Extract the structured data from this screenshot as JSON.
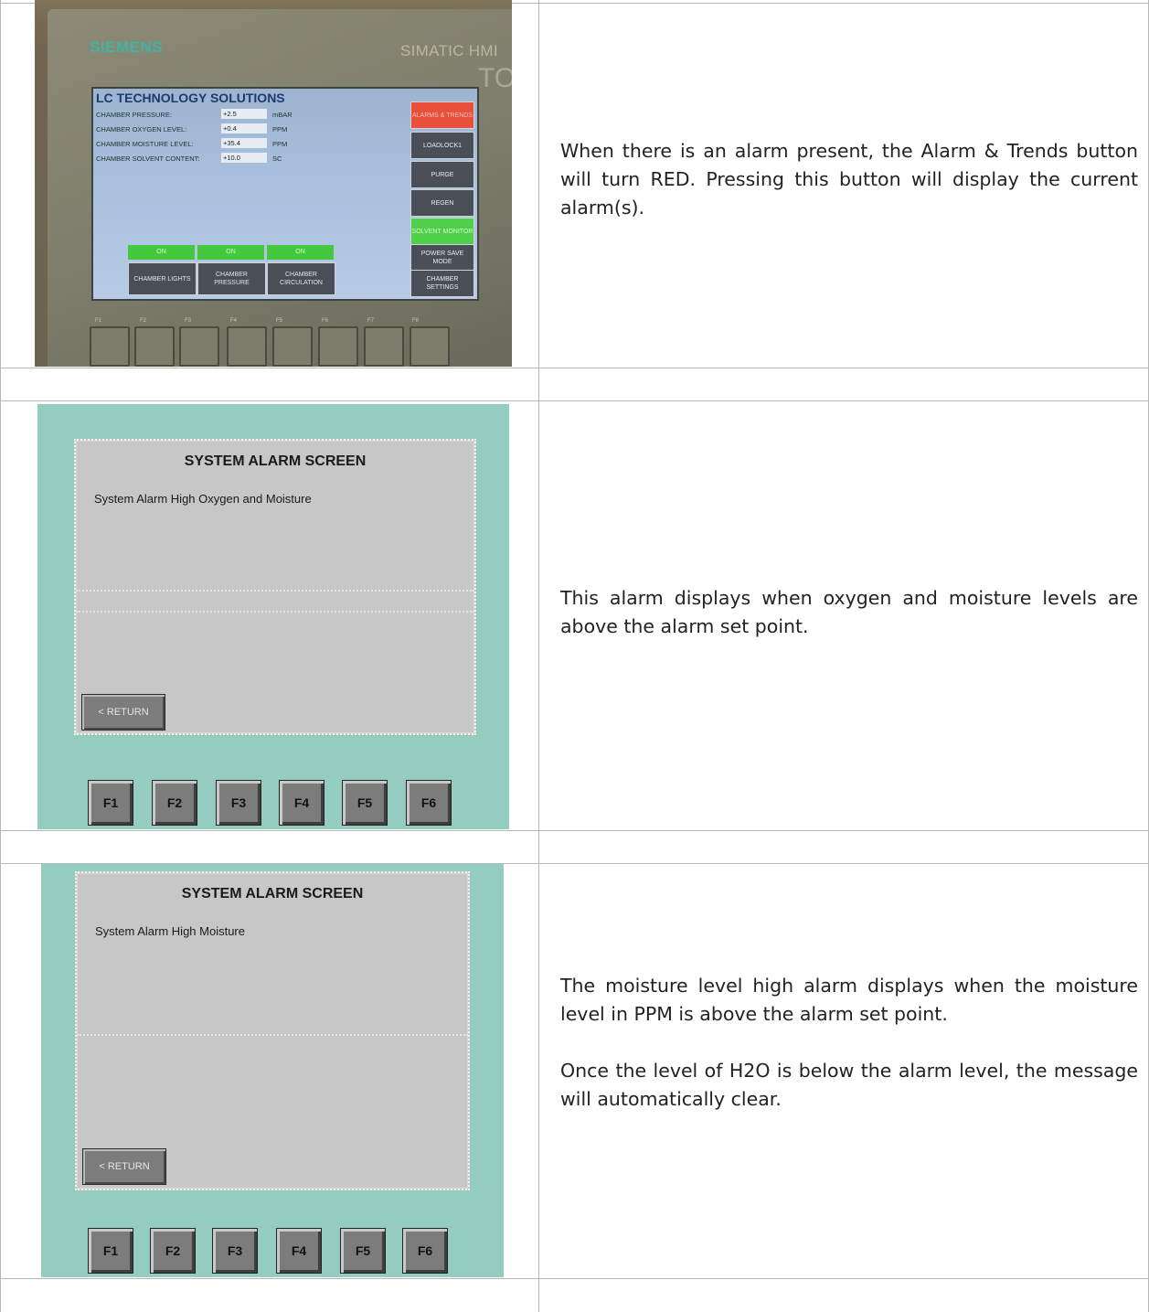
{
  "row1": {
    "description": "When there is an alarm present, the Alarm & Trends button will turn RED. Pressing this button will display the current alarm(s).",
    "photo": {
      "brand": "SIEMENS",
      "model": "SIMATIC HMI",
      "touch_label": "TOUCH",
      "screen_title": "LC TECHNOLOGY SOLUTIONS",
      "readings": [
        {
          "label": "CHAMBER PRESSURE:",
          "value": "+2.5",
          "unit": "mBAR"
        },
        {
          "label": "CHAMBER OXYGEN LEVEL:",
          "value": "+0.4",
          "unit": "PPM"
        },
        {
          "label": "CHAMBER MOISTURE LEVEL:",
          "value": "+35.4",
          "unit": "PPM"
        },
        {
          "label": "CHAMBER SOLVENT CONTENT:",
          "value": "+10.0",
          "unit": "SC"
        }
      ],
      "side_buttons": [
        "ALARMS & TRENDS",
        "LOADLOCK1",
        "PURGE",
        "REGEN",
        "SOLVENT MONITOR",
        "POWER SAVE MODE",
        "CHAMBER SETTINGS"
      ],
      "side_button_colors": {
        "alarm": "#e8503b",
        "solvent": "#4fd04a",
        "default": "#4a4f57"
      },
      "on_labels": [
        "ON",
        "ON",
        "ON"
      ],
      "bottom_buttons": [
        "CHAMBER LIGHTS",
        "CHAMBER PRESSURE",
        "CHAMBER CIRCULATION"
      ],
      "fkey_labels": [
        "F1",
        "F2",
        "F3",
        "F4",
        "F5",
        "F6",
        "F7",
        "F8"
      ]
    }
  },
  "row2": {
    "description": "This alarm displays when oxygen and moisture levels are above the alarm set point.",
    "panel": {
      "title": "SYSTEM ALARM SCREEN",
      "message": "System Alarm High Oxygen and Moisture",
      "return_label": "< RETURN",
      "fkeys": [
        "F1",
        "F2",
        "F3",
        "F4",
        "F5",
        "F6"
      ]
    }
  },
  "row3": {
    "description_1": "The moisture level high alarm displays when the moisture level in PPM is above the alarm set point.",
    "description_2": "Once the level of H2O is below the alarm level, the message will automatically clear.",
    "panel": {
      "title": "SYSTEM ALARM SCREEN",
      "message": "System Alarm High Moisture",
      "return_label": "< RETURN",
      "fkeys": [
        "F1",
        "F2",
        "F3",
        "F4",
        "F5",
        "F6"
      ]
    }
  }
}
